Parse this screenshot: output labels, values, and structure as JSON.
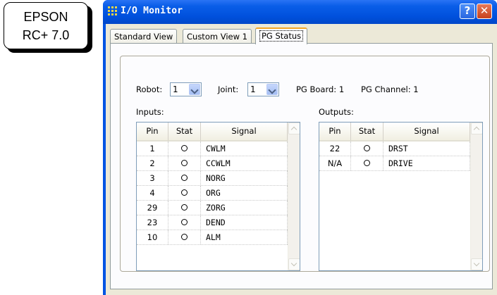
{
  "badge": {
    "line1": "EPSON",
    "line2": "RC+ 7.0"
  },
  "window": {
    "title": "I/O Monitor",
    "help_label": "?",
    "close_label": "✕",
    "icon": "app-grid-icon"
  },
  "tabs": [
    {
      "label": "Standard View",
      "active": false
    },
    {
      "label": "Custom View 1",
      "active": false
    },
    {
      "label": "PG Status",
      "active": true
    }
  ],
  "selectors": {
    "robot_label": "Robot:",
    "robot_value": "1",
    "joint_label": "Joint:",
    "joint_value": "1",
    "pg_board": "PG Board: 1",
    "pg_channel": "PG Channel: 1"
  },
  "inputs": {
    "label": "Inputs:",
    "columns": [
      "Pin",
      "Stat",
      "Signal"
    ],
    "rows": [
      {
        "pin": "1",
        "signal": "CWLM"
      },
      {
        "pin": "2",
        "signal": "CCWLM"
      },
      {
        "pin": "3",
        "signal": "NORG"
      },
      {
        "pin": "4",
        "signal": "ORG"
      },
      {
        "pin": "29",
        "signal": "ZORG"
      },
      {
        "pin": "23",
        "signal": "DEND"
      },
      {
        "pin": "10",
        "signal": "ALM"
      }
    ]
  },
  "outputs": {
    "label": "Outputs:",
    "columns": [
      "Pin",
      "Stat",
      "Signal"
    ],
    "rows": [
      {
        "pin": "22",
        "signal": "DRST"
      },
      {
        "pin": "N/A",
        "signal": "DRIVE"
      }
    ]
  },
  "colors": {
    "titlebar": "#0054e3",
    "client": "#ece9d8",
    "active_tab_accent": "#f5a623",
    "close_button": "#c8421d"
  }
}
